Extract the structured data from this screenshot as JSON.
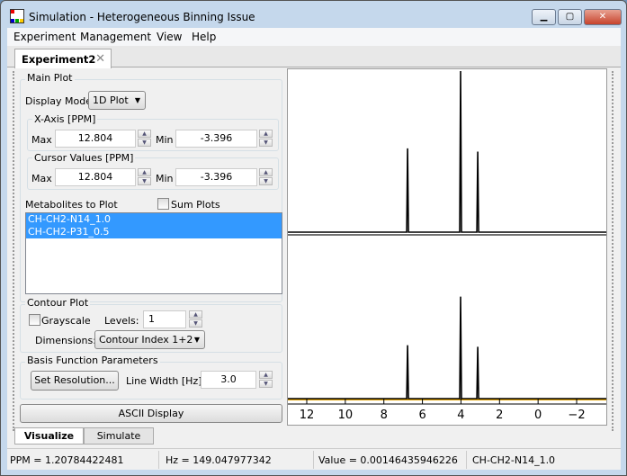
{
  "window": {
    "title": "Simulation - Heterogeneous Binning Issue"
  },
  "menu": [
    "Experiment",
    "Management",
    "View",
    "Help"
  ],
  "tab": {
    "label": "Experiment2"
  },
  "main_plot": {
    "group_label": "Main Plot",
    "display_mode_label": "Display Mode",
    "display_mode_value": "1D Plot",
    "xaxis": {
      "label": "X-Axis [PPM]",
      "max_label": "Max",
      "max": "12.804",
      "min_label": "Min",
      "min": "-3.396"
    },
    "cursor": {
      "label": "Cursor Values [PPM]",
      "max_label": "Max",
      "max": "12.804",
      "min_label": "Min",
      "min": "-3.396"
    },
    "metabolites_label": "Metabolites to Plot",
    "sum_plots_label": "Sum Plots",
    "metabolites": [
      "CH-CH2-N14_1.0",
      "CH-CH2-P31_0.5"
    ]
  },
  "contour": {
    "group_label": "Contour Plot",
    "grayscale_label": "Grayscale",
    "levels_label": "Levels:",
    "levels": "1",
    "dimensions_label": "Dimensions:",
    "dimensions_value": "Contour Index 1+2"
  },
  "basis": {
    "group_label": "Basis Function Parameters",
    "set_resolution": "Set Resolution...",
    "line_width_label": "Line Width [Hz]:",
    "line_width": "3.0"
  },
  "ascii_button": "ASCII Display",
  "bottom_tabs": [
    "Visualize",
    "Simulate"
  ],
  "status": {
    "ppm": "PPM = 1.20784422481",
    "hz": "Hz = 149.047977342",
    "value": "Value = 0.00146435946226",
    "metabolite": "CH-CH2-N14_1.0"
  },
  "chart_data": {
    "type": "line",
    "xlabel": "PPM",
    "xlim": [
      13,
      -3.4
    ],
    "xticks": [
      12,
      10,
      8,
      6,
      4,
      2,
      0,
      -2
    ],
    "xtick_labels": [
      "12",
      "10",
      "8",
      "6",
      "4",
      "2",
      "0",
      "−2"
    ],
    "series": [
      {
        "name": "CH-CH2-N14_1.0",
        "color": "#000000",
        "peaks": [
          {
            "ppm": 6.77,
            "height": 0.52
          },
          {
            "ppm": 4.02,
            "height": 1.0
          },
          {
            "ppm": 3.13,
            "height": 0.5
          }
        ]
      },
      {
        "name": "CH-CH2-P31_0.5",
        "color": "#000000",
        "peaks": [
          {
            "ppm": 6.77,
            "height": 0.33
          },
          {
            "ppm": 4.02,
            "height": 0.63
          },
          {
            "ppm": 3.13,
            "height": 0.32
          }
        ],
        "baseline_color": "#e0a000"
      }
    ]
  }
}
